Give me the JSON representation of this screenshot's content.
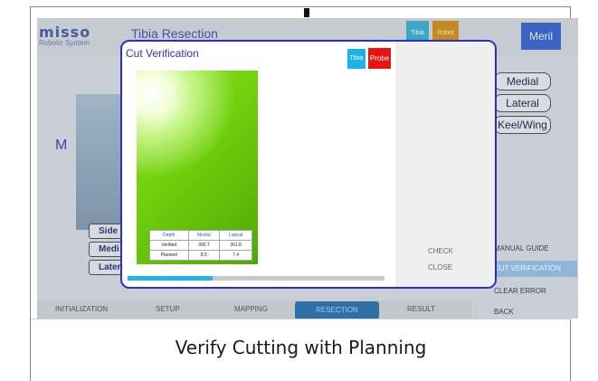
{
  "app": {
    "logo": "misso",
    "logo_subtitle": "Robotic System",
    "title": "Tibia Resection",
    "badge_tibia": "Tibia",
    "badge_robot": "Robot",
    "menu_label": "Meril",
    "side_letter": "M"
  },
  "right_buttons": [
    "Medial",
    "Lateral",
    "Keel/Wing"
  ],
  "left_mini": [
    "Side",
    "Medi",
    "Later"
  ],
  "right_menu": {
    "manual_guide": "MANUAL GUIDE",
    "cut_verification": "CUT VERIFICATION",
    "clear_error": "CLEAR ERROR",
    "back": "BACK"
  },
  "bottom_nav": [
    "INITIALIZATION",
    "SETUP",
    "MAPPING",
    "RESECTION",
    "RESULT"
  ],
  "modal": {
    "title": "Cut Verification",
    "pill_tibia": "Tibia",
    "pill_probe": "Probe",
    "table": {
      "headers": [
        "Depth",
        "Medial",
        "Lateral"
      ],
      "rows": [
        [
          "Verified",
          "300.7",
          "301.8"
        ],
        [
          "Planned",
          "8.5",
          "7.4"
        ]
      ]
    },
    "progress_fraction": 0.33,
    "check_label": "CHECK",
    "close_label": "CLOSE"
  },
  "caption": "Verify Cutting with Planning",
  "colors": {
    "modal_border": "#2c2ec6",
    "probe_red": "#ee1111",
    "tibia_cyan": "#1ab3e8",
    "progress": "#22b5ee"
  }
}
